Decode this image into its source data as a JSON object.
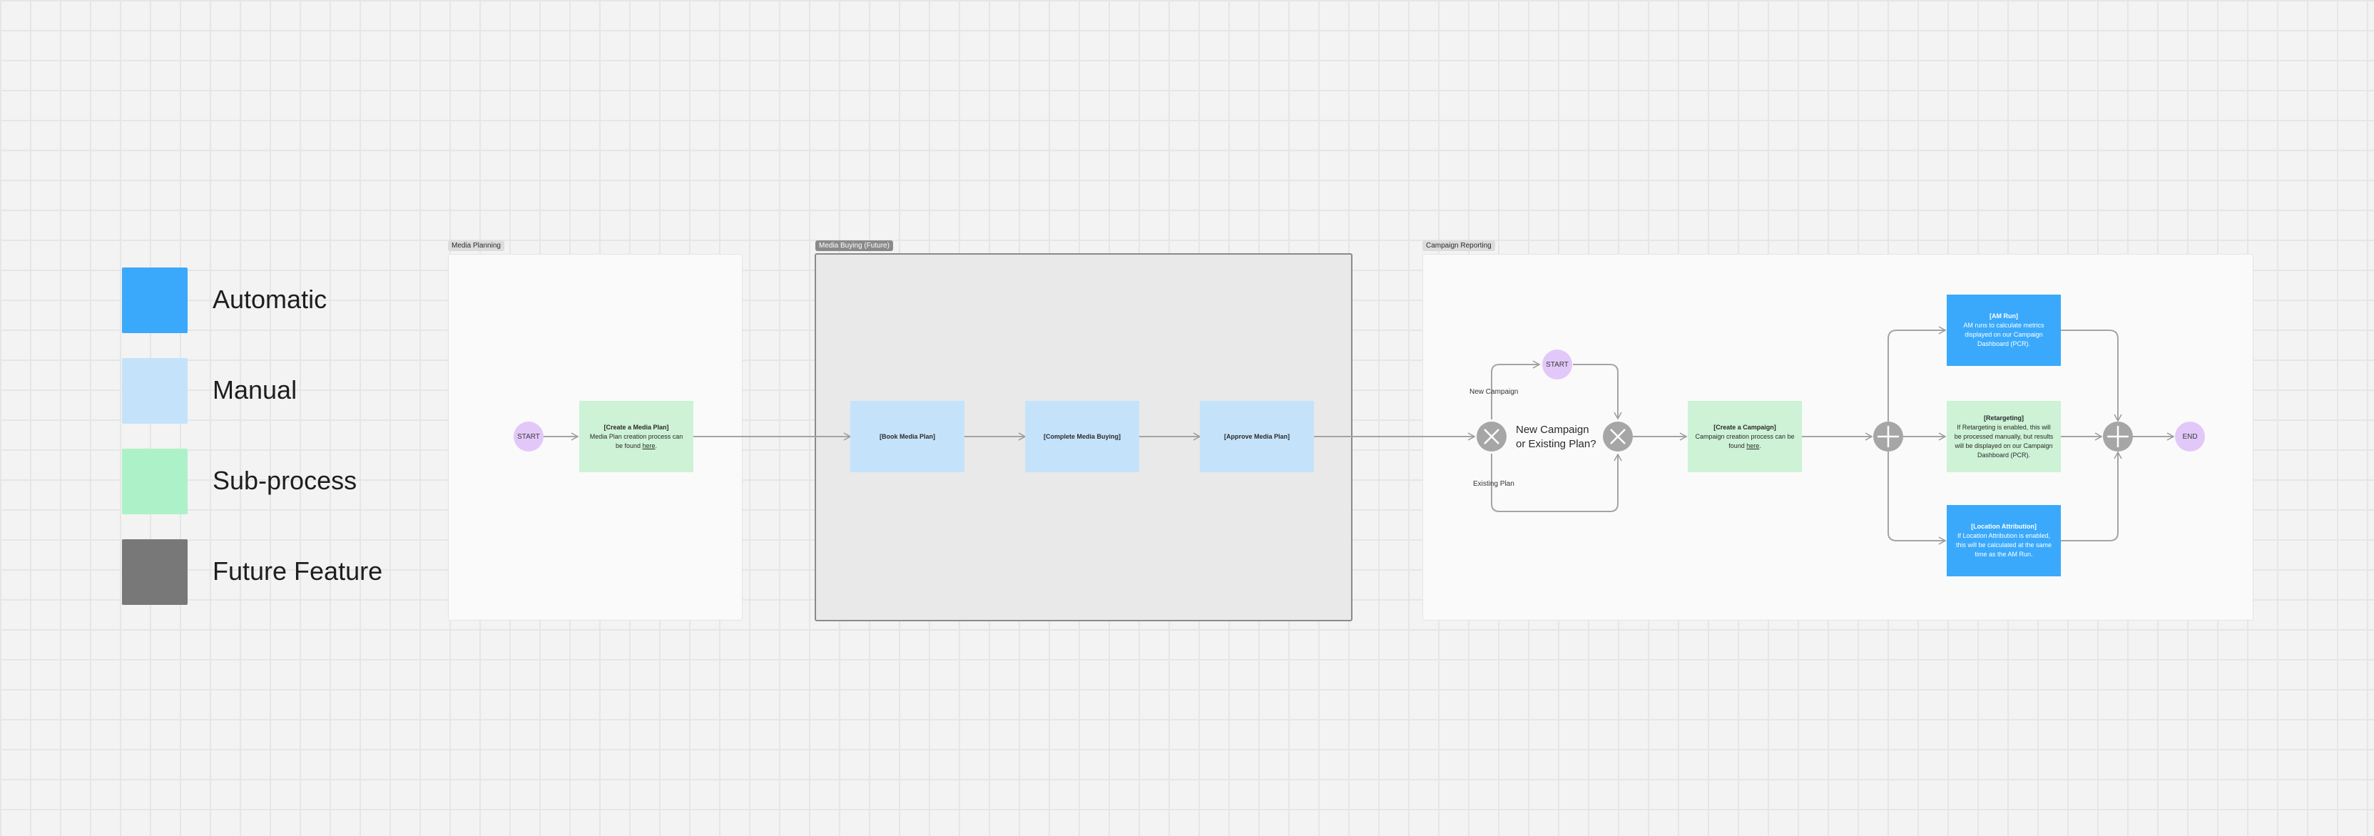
{
  "legend": {
    "items": [
      {
        "label": "Automatic",
        "color": "#3aa9fb"
      },
      {
        "label": "Manual",
        "color": "#c4e3fb"
      },
      {
        "label": "Sub-process",
        "color": "#adf1c8"
      },
      {
        "label": "Future Feature",
        "color": "#787878"
      }
    ]
  },
  "sections": {
    "media_planning": {
      "label": "Media Planning"
    },
    "media_buying": {
      "label": "Media Buying (Future)"
    },
    "campaign_reporting": {
      "label": "Campaign Reporting"
    }
  },
  "media_planning": {
    "start": "START",
    "create_plan": {
      "title": "[Create a Media Plan]",
      "text_before": "Media Plan creation process can be found",
      "link": "here",
      "text_after": "."
    }
  },
  "media_buying": {
    "book": "[Book Media Plan]",
    "complete": "[Complete Media Buying]",
    "approve": "[Approve Media Plan]"
  },
  "campaign_reporting": {
    "start": "START",
    "new_campaign_label": "New Campaign",
    "existing_plan_label": "Existing Plan",
    "question": "New Campaign or Existing Plan?",
    "create_campaign": {
      "title": "[Create a Campaign]",
      "text_before": "Campaign creation process can be found",
      "link": "here",
      "text_after": "."
    },
    "am_run": {
      "title": "[AM Run]",
      "text": "AM runs to calculate metrics displayed on our Campaign Dashboard (PCR)."
    },
    "retargeting": {
      "title": "[Retargeting]",
      "text": "If Retargeting is enabled, this will be processed manually, but results will be displayed on our Campaign Dashboard (PCR)."
    },
    "location_attribution": {
      "title": "[Location Attribution]",
      "text": "If Location Attribution is enabled, this will be calculated at the same time as the AM Run."
    },
    "end": "END"
  }
}
